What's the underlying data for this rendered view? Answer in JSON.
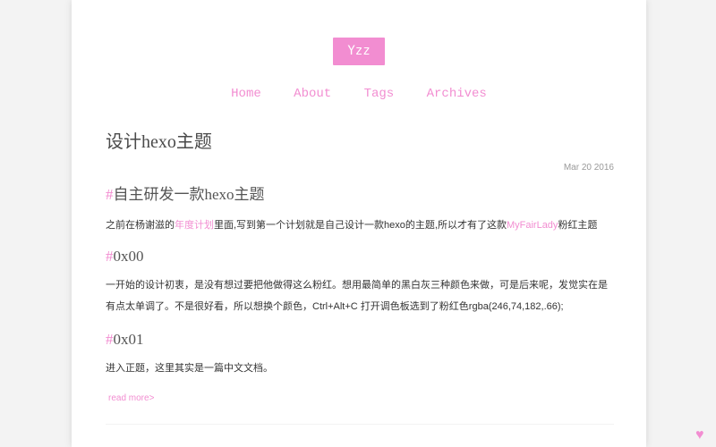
{
  "site": {
    "logo_text": "Yzz",
    "nav": {
      "home": "Home",
      "about": "About",
      "tags": "Tags",
      "archives": "Archives"
    }
  },
  "post": {
    "title": "设计hexo主题",
    "date": "Mar 20 2016",
    "section1": {
      "hash": "#",
      "heading": "自主研发一款hexo主题",
      "text_before_link1": "之前在杨谢滋的",
      "link1": "年度计划",
      "text_between": "里面,写到第一个计划就是自己设计一款hexo的主题,所以才有了这款",
      "link2": "MyFairLady",
      "text_after_link2": "粉红主题"
    },
    "section2": {
      "hash": "#",
      "heading": "0x00",
      "text": "一开始的设计初衷，是没有想过要把他做得这么粉红。想用最简单的黑白灰三种颜色来做，可是后来呢，发觉实在是有点太单调了。不是很好看，所以想换个颜色，Ctrl+Alt+C 打开调色板选到了粉红色rgba(246,74,182,.66);"
    },
    "section3": {
      "hash": "#",
      "heading": "0x01",
      "text": "进入正题，这里其实是一篇中文文档。"
    },
    "read_more": "read more>"
  },
  "heart": {
    "icon_glyph": "♥",
    "icon_name": "heart-icon"
  },
  "colors": {
    "accent": "#f28dd1",
    "text": "#333333",
    "muted": "#999999"
  }
}
